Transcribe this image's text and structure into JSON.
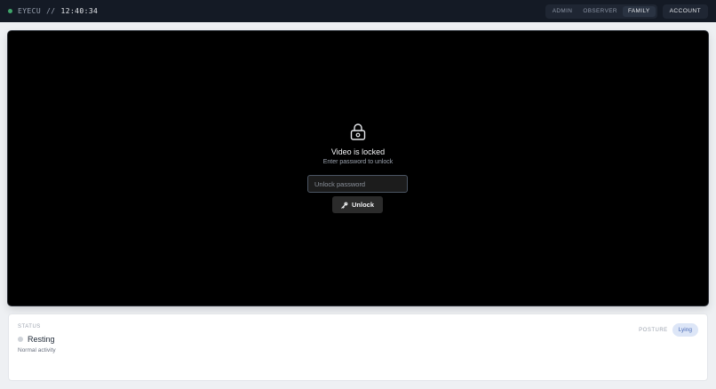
{
  "header": {
    "brand": "EYECU",
    "separator": "//",
    "clock": "12:40:34",
    "roles": [
      "ADMIN",
      "OBSERVER",
      "FAMILY"
    ],
    "active_role": "FAMILY",
    "account_label": "ACCOUNT"
  },
  "video": {
    "lock_title": "Video is locked",
    "lock_subtitle": "Enter password to unlock",
    "password_placeholder": "Unlock password",
    "password_value": "",
    "unlock_label": "Unlock"
  },
  "status": {
    "label": "STATUS",
    "value": "Resting",
    "description": "Normal activity",
    "posture_label": "POSTURE",
    "posture_value": "Lying"
  },
  "colors": {
    "topbar": "#141a25",
    "live_dot": "#3fa46a",
    "posture_badge_bg": "#dde6f7",
    "posture_badge_text": "#4b6cb7"
  },
  "icons": {
    "lock": "lock-icon",
    "key": "key-icon",
    "live": "live-status-dot"
  }
}
